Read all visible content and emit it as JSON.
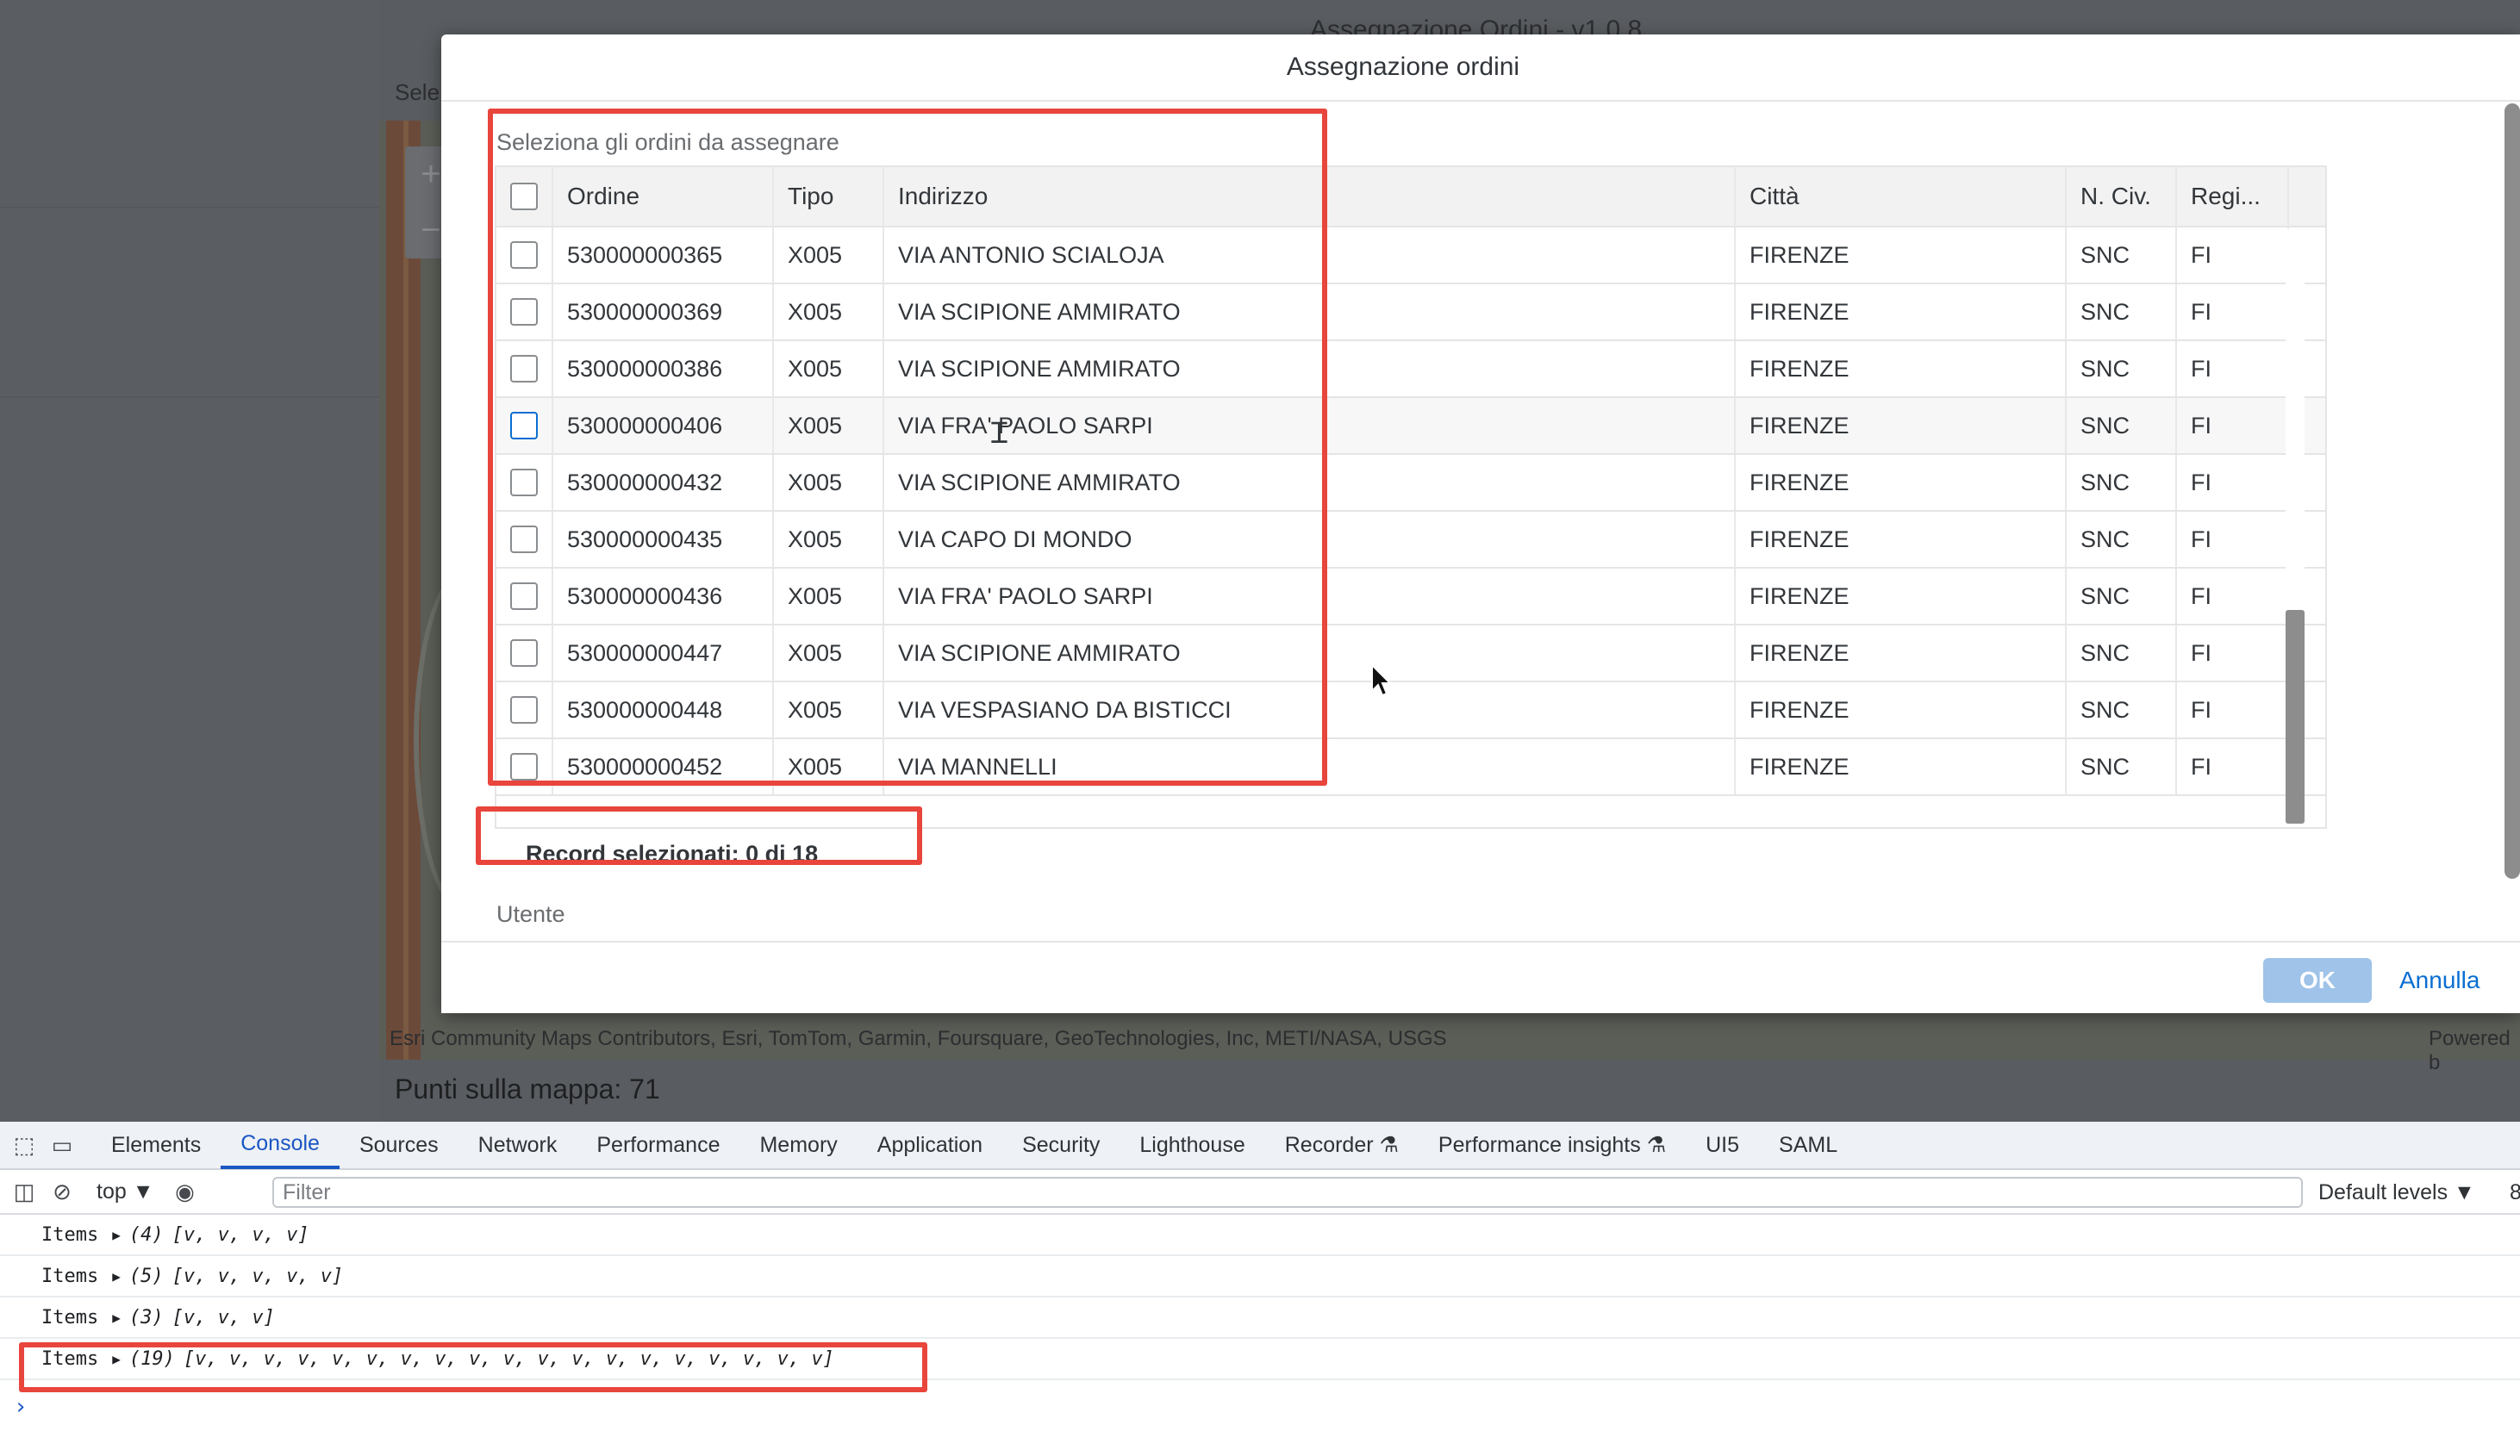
{
  "app": {
    "title": "Assegnazione Ordini - v1.0.8",
    "select_label": "Sele",
    "map_attribution": "Esri Community Maps Contributors, Esri, TomTom, Garmin, Foursquare, GeoTechnologies, Inc, METI/NASA, USGS",
    "map_powered": "Powered b",
    "points_label": "Punti sulla mappa: 71",
    "zoom_in": "+",
    "zoom_out": "−"
  },
  "dialog": {
    "title": "Assegnazione ordini",
    "section_label": "Seleziona gli ordini da assegnare",
    "columns": [
      "Ordine",
      "Tipo",
      "Indirizzo",
      "Città",
      "N. Civ.",
      "Regi..."
    ],
    "rows": [
      {
        "ordine": "530000000365",
        "tipo": "X005",
        "indirizzo": "VIA ANTONIO SCIALOJA",
        "citta": "FIRENZE",
        "civ": "SNC",
        "reg": "FI"
      },
      {
        "ordine": "530000000369",
        "tipo": "X005",
        "indirizzo": "VIA SCIPIONE AMMIRATO",
        "citta": "FIRENZE",
        "civ": "SNC",
        "reg": "FI"
      },
      {
        "ordine": "530000000386",
        "tipo": "X005",
        "indirizzo": "VIA SCIPIONE AMMIRATO",
        "citta": "FIRENZE",
        "civ": "SNC",
        "reg": "FI"
      },
      {
        "ordine": "530000000406",
        "tipo": "X005",
        "indirizzo": "VIA FRA' PAOLO SARPI",
        "citta": "FIRENZE",
        "civ": "SNC",
        "reg": "FI"
      },
      {
        "ordine": "530000000432",
        "tipo": "X005",
        "indirizzo": "VIA SCIPIONE AMMIRATO",
        "citta": "FIRENZE",
        "civ": "SNC",
        "reg": "FI"
      },
      {
        "ordine": "530000000435",
        "tipo": "X005",
        "indirizzo": "VIA CAPO DI MONDO",
        "citta": "FIRENZE",
        "civ": "SNC",
        "reg": "FI"
      },
      {
        "ordine": "530000000436",
        "tipo": "X005",
        "indirizzo": "VIA FRA' PAOLO SARPI",
        "citta": "FIRENZE",
        "civ": "SNC",
        "reg": "FI"
      },
      {
        "ordine": "530000000447",
        "tipo": "X005",
        "indirizzo": "VIA SCIPIONE AMMIRATO",
        "citta": "FIRENZE",
        "civ": "SNC",
        "reg": "FI"
      },
      {
        "ordine": "530000000448",
        "tipo": "X005",
        "indirizzo": "VIA VESPASIANO DA BISTICCI",
        "citta": "FIRENZE",
        "civ": "SNC",
        "reg": "FI"
      },
      {
        "ordine": "530000000452",
        "tipo": "X005",
        "indirizzo": "VIA MANNELLI",
        "citta": "FIRENZE",
        "civ": "SNC",
        "reg": "FI"
      }
    ],
    "record_count": "Record selezionati: 0 di 18",
    "utente_label": "Utente",
    "utente_value": "",
    "ok_label": "OK",
    "cancel_label": "Annulla"
  },
  "devtools": {
    "tabs": [
      "Elements",
      "Console",
      "Sources",
      "Network",
      "Performance",
      "Memory",
      "Application",
      "Security",
      "Lighthouse",
      "Recorder ⚗",
      "Performance insights ⚗",
      "UI5",
      "SAML"
    ],
    "active_tab": "Console",
    "context": "top ▼",
    "filter_placeholder": "Filter",
    "levels": "Default levels ▼",
    "issues": "8",
    "logs": [
      {
        "key": "Items",
        "count": "(4)",
        "value": "[v, v, v, v]"
      },
      {
        "key": "Items",
        "count": "(5)",
        "value": "[v, v, v, v, v]"
      },
      {
        "key": "Items",
        "count": "(3)",
        "value": "[v, v, v]"
      },
      {
        "key": "Items",
        "count": "(19)",
        "value": "[v, v, v, v, v, v, v, v, v, v, v, v, v, v, v, v, v, v, v]"
      }
    ],
    "prompt": "›"
  },
  "colors": {
    "highlight": "#e8453c",
    "accent": "#0a6ed1",
    "devtools_active": "#1a56c4"
  }
}
